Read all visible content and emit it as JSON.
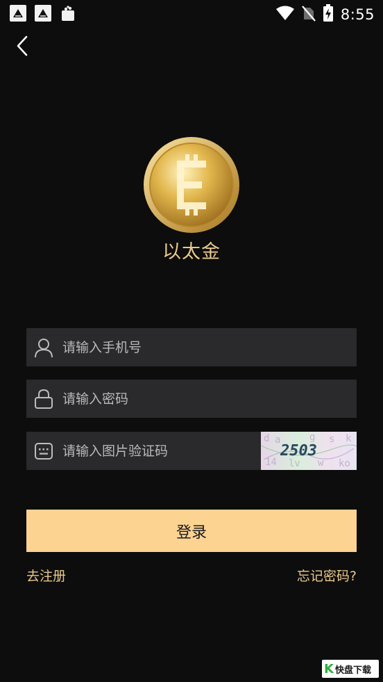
{
  "status_bar": {
    "time": "8:55",
    "left_icons": [
      "app-notification-icon",
      "app-notification-icon",
      "shopping-bag-icon"
    ],
    "right_icons": [
      "wifi-icon",
      "no-sim-icon",
      "battery-charging-icon"
    ]
  },
  "header": {
    "back_icon": "chevron-left-icon"
  },
  "brand": {
    "app_name": "以太金",
    "logo_letter": "E"
  },
  "form": {
    "phone_placeholder": "请输入手机号",
    "password_placeholder": "请输入密码",
    "captcha_placeholder": "请输入图片验证码",
    "captcha_text": "2503",
    "login_label": "登录"
  },
  "links": {
    "register": "去注册",
    "forgot": "忘记密码?"
  },
  "watermark": {
    "logo": "K",
    "text": "快盘下载"
  },
  "colors": {
    "accent": "#fdd392",
    "gold_text": "#e9c98c",
    "field_bg": "#2a2a2d",
    "background": "#0d0d0d"
  }
}
